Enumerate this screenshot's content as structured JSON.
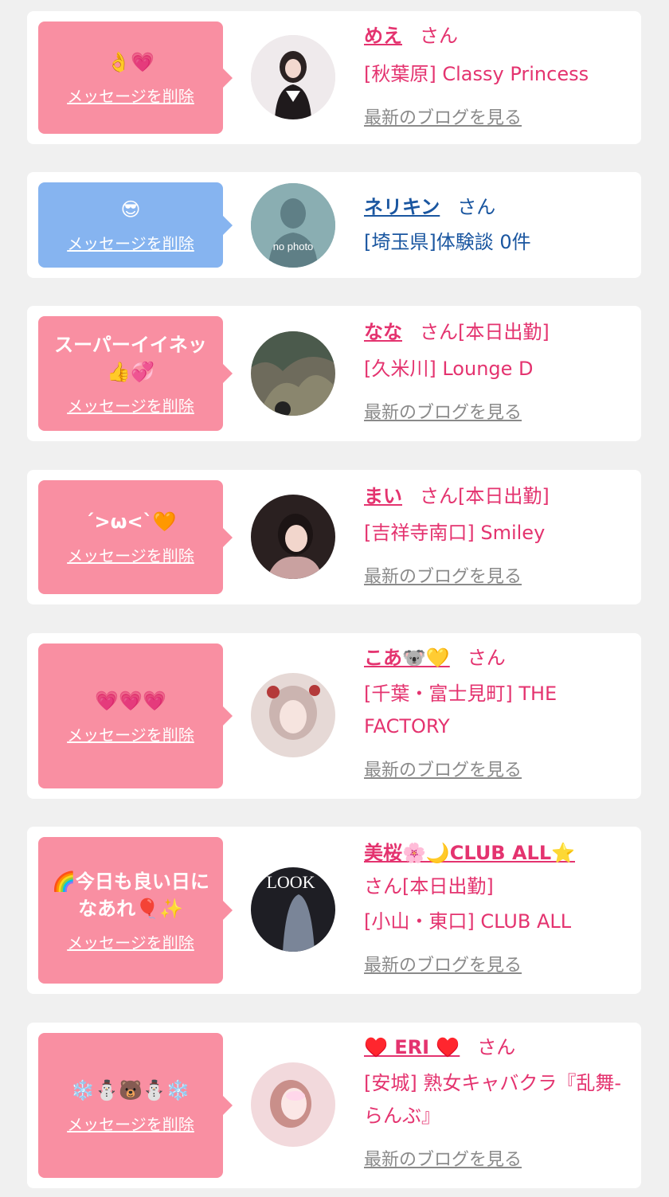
{
  "ui": {
    "delete_label": "メッセージを削除",
    "blog_label": "最新のブログを見る",
    "san": "さん"
  },
  "cards": [
    {
      "message": "👌💗",
      "name": "めえ",
      "tag": "",
      "shop": "[秋葉原] Classy Princess"
    },
    {
      "message": "😎",
      "name": "ネリキン",
      "tag": "",
      "shop": "[埼玉県]体験談 0件",
      "avatar_text": "no photo"
    },
    {
      "message": "スーパーイイネッ👍💞",
      "name": "なな",
      "tag": "[本日出勤]",
      "shop": "[久米川] Lounge D"
    },
    {
      "message": "´>ω<`🧡",
      "name": "まい",
      "tag": "[本日出勤]",
      "shop": "[吉祥寺南口] Smiley"
    },
    {
      "message": "💗💗💗",
      "name": "こあ🐨💛",
      "tag": "",
      "shop": "[千葉・富士見町] THE FACTORY"
    },
    {
      "message": "🌈今日も良い日になあれ🎈✨",
      "name": "美桜🌸🌙CLUB ALL⭐",
      "tag": "[本日出勤]",
      "shop": "[小山・東口] CLUB ALL",
      "avatar_text": "LOOK"
    },
    {
      "message": "❄️⛄🐻⛄❄️",
      "name": "♥️ ERI ♥️",
      "tag": "",
      "shop": "[安城] 熟女キャバクラ『乱舞-らんぶ』"
    }
  ],
  "colors": {
    "pink_bubble": "#f98fa2",
    "blue_bubble": "#86b4f0",
    "name_pink": "#e4336f",
    "name_blue": "#1a56a0",
    "link_gray": "#8a8a8a"
  }
}
